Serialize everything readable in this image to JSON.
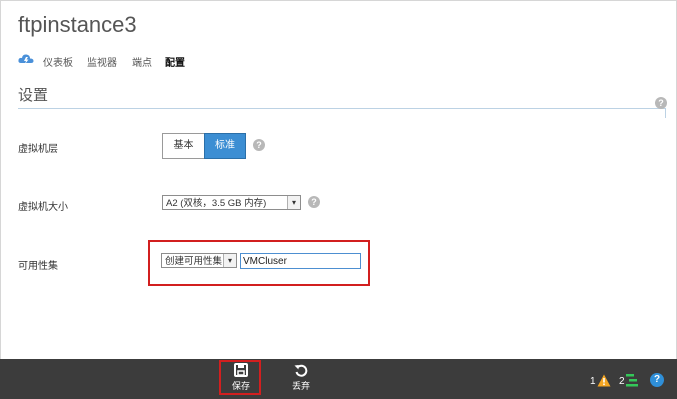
{
  "header": {
    "title": "ftpinstance3"
  },
  "tabs": [
    {
      "label": "仪表板",
      "active": false
    },
    {
      "label": "监视器",
      "active": false
    },
    {
      "label": "端点",
      "active": false
    },
    {
      "label": "配置",
      "active": true
    }
  ],
  "section": {
    "title": "设置"
  },
  "settings": {
    "tier": {
      "label": "虚拟机层",
      "options": [
        "基本",
        "标准"
      ],
      "selected": "标准"
    },
    "size": {
      "label": "虚拟机大小",
      "value": "A2 (双核，3.5 GB 内存)"
    },
    "availability": {
      "label": "可用性集",
      "mode_value": "创建可用性集",
      "name_value": "VMCluser"
    }
  },
  "command_bar": {
    "save_label": "保存",
    "discard_label": "丢弃",
    "warning_count": "1",
    "progress_count": "2"
  },
  "colors": {
    "accent": "#3c8ed3",
    "command_bar": "#3c3c3c",
    "highlight": "#d21f1f",
    "warning": "#f5a623",
    "progress": "#34c759"
  },
  "icons": [
    "cloud-icon",
    "help-icon",
    "dropdown-arrow-icon",
    "save-icon",
    "undo-icon",
    "warning-icon",
    "progress-icon",
    "question-icon"
  ]
}
